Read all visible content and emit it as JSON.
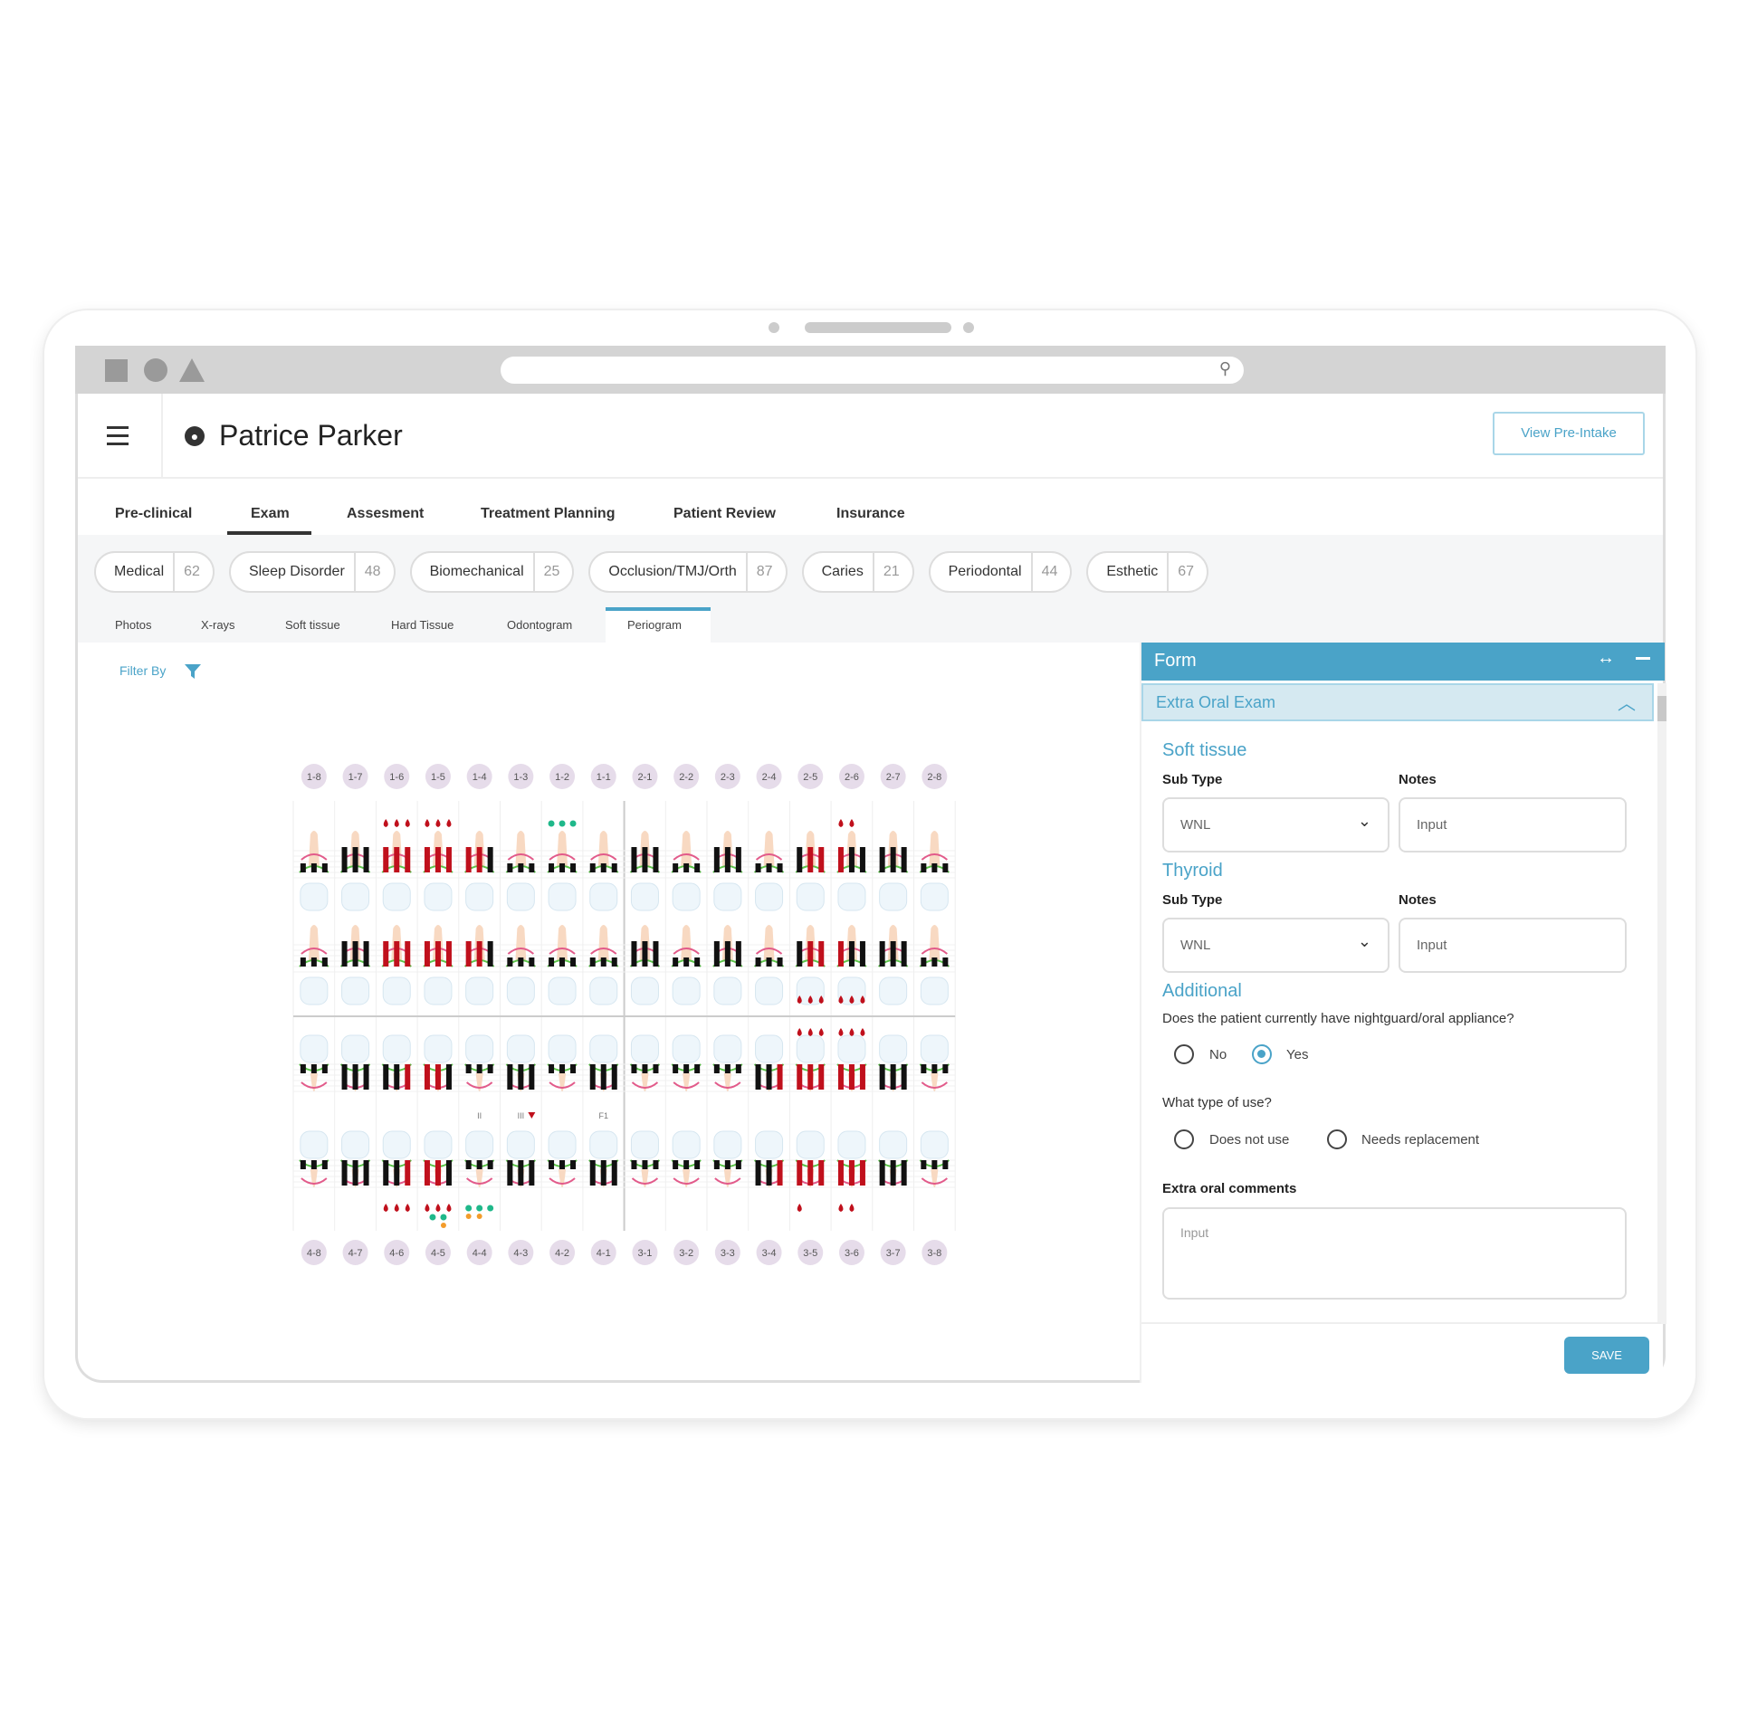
{
  "patient": {
    "name": "Patrice Parker",
    "view_preintake": "View Pre-Intake"
  },
  "tabs": [
    "Pre-clinical",
    "Exam",
    "Assesment",
    "Treatment Planning",
    "Patient Review",
    "Insurance"
  ],
  "active_tab": "Exam",
  "chips": [
    {
      "label": "Medical",
      "count": "62"
    },
    {
      "label": "Sleep Disorder",
      "count": "48"
    },
    {
      "label": "Biomechanical",
      "count": "25"
    },
    {
      "label": "Occlusion/TMJ/Orth",
      "count": "87"
    },
    {
      "label": "Caries",
      "count": "21"
    },
    {
      "label": "Periodontal",
      "count": "44"
    },
    {
      "label": "Esthetic",
      "count": "67"
    }
  ],
  "subtabs": [
    "Photos",
    "X-rays",
    "Soft tissue",
    "Hard Tissue",
    "Odontogram",
    "Periogram"
  ],
  "active_subtab": "Periogram",
  "filter": {
    "label": "Filter By"
  },
  "chart": {
    "upper_numbers": [
      "1-8",
      "1-7",
      "1-6",
      "1-5",
      "1-4",
      "1-3",
      "1-2",
      "1-1",
      "2-1",
      "2-2",
      "2-3",
      "2-4",
      "2-5",
      "2-6",
      "2-7",
      "2-8"
    ],
    "lower_numbers": [
      "4-8",
      "4-7",
      "4-6",
      "4-5",
      "4-4",
      "4-3",
      "4-2",
      "4-1",
      "3-1",
      "3-2",
      "3-3",
      "3-4",
      "3-5",
      "3-6",
      "3-7",
      "3-8"
    ],
    "upper_pockets": [
      "s",
      "b",
      "r",
      "r",
      "h",
      "s",
      "s",
      "s",
      "b",
      "s",
      "b",
      "s",
      "x",
      "y",
      "b",
      "s"
    ],
    "lower_pockets": [
      "s",
      "b",
      "l",
      "m",
      "s",
      "b",
      "s",
      "b",
      "s",
      "s",
      "s",
      "l",
      "r",
      "r",
      "b",
      "s"
    ],
    "markers_row1": {
      "1-6": {
        "bleeding": 3
      },
      "1-5": {
        "bleeding": 3
      },
      "1-2": {
        "green": 3
      },
      "2-6": {
        "bleeding": 2
      }
    },
    "markers_row2": {
      "2-5": {
        "bleeding": 3
      },
      "2-6": {
        "bleeding": 3
      }
    },
    "markers_row3": {
      "2-5": {
        "bleeding": 3
      },
      "2-6": {
        "bleeding": 3
      }
    },
    "markers_row4": {
      "4-6": {
        "bleeding": 3
      },
      "4-5": {
        "bleeding": 3,
        "green": 2,
        "orange": 1
      },
      "4-4": {
        "green": 3,
        "orange": 2
      },
      "3-5": {
        "bleeding": 1
      },
      "3-6": {
        "bleeding": 2
      }
    },
    "furcation_labels": {
      "4-4": "II",
      "4-3": "III",
      "4-1": "F1"
    },
    "colors": {
      "bleeding": "#c0101c",
      "green": "#1fb88a",
      "orange": "#f39c2b",
      "pocket": "#111111",
      "number_bg": "#e6dcea"
    }
  },
  "form": {
    "title": "Form",
    "section": "Extra Oral Exam",
    "soft_tissue": {
      "title": "Soft tissue",
      "subtype_label": "Sub Type",
      "subtype_value": "WNL",
      "notes_label": "Notes",
      "notes_placeholder": "Input"
    },
    "thyroid": {
      "title": "Thyroid",
      "subtype_label": "Sub Type",
      "subtype_value": "WNL",
      "notes_label": "Notes",
      "notes_placeholder": "Input"
    },
    "additional": {
      "title": "Additional",
      "q1": "Does the patient currently have nightguard/oral appliance?",
      "q1_options": [
        "No",
        "Yes"
      ],
      "q1_selected": "Yes",
      "q2": "What type of use?",
      "q2_options": [
        "Does not use",
        "Needs replacement"
      ],
      "comments_label": "Extra oral comments",
      "comments_placeholder": "Input"
    },
    "save": "SAVE",
    "accent": "#4aa3c8"
  }
}
